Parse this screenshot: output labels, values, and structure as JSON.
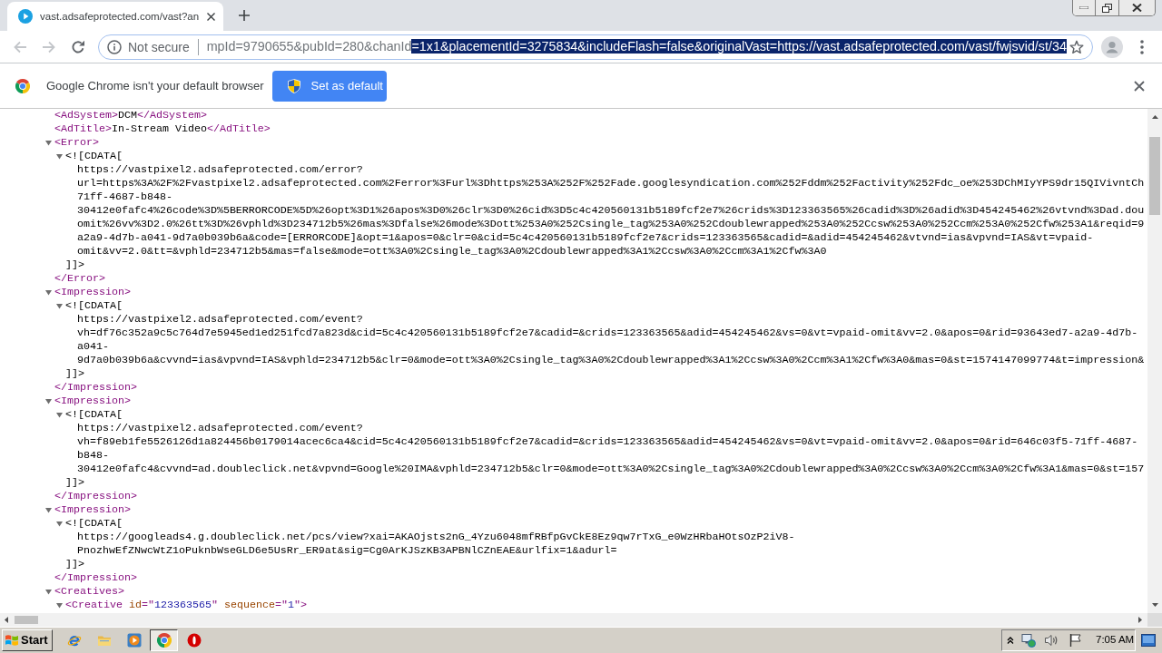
{
  "tabs": [
    {
      "title": "vast.adsafeprotected.com/vast?an",
      "selected": true
    }
  ],
  "toolbar": {
    "back_disabled": true,
    "forward_disabled": true,
    "security_label": "Not secure",
    "url": "mpId=9790655&pubId=280&chanId",
    "url_selection": "=1x1&placementId=3275834&includeFlash=false&originalVast=https://vast.adsafeprotected.com/vast/fwjsvid/st/34"
  },
  "infobar": {
    "message": "Google Chrome isn't your default browser",
    "button": "Set as default"
  },
  "document": [
    {
      "kind": "leaf",
      "open": "<AdSystem>",
      "text": "DCM",
      "close": "</AdSystem>"
    },
    {
      "kind": "leaf",
      "open": "<AdTitle>",
      "text": "In-Stream Video",
      "close": "</AdTitle>"
    },
    {
      "kind": "element",
      "expanded": true,
      "open": "<Error>",
      "children": [
        {
          "kind": "cdata",
          "expanded": true,
          "open": "<![CDATA[",
          "lines": [
            "https://vastpixel2.adsafeprotected.com/error?",
            "url=https%3A%2F%2Fvastpixel2.adsafeprotected.com%2Ferror%3Furl%3Dhttps%253A%252F%252Fade.googlesyndication.com%252Fddm%252Factivity%252Fdc_oe%253DChMIyYPS9dr15QIVivntCh",
            "71ff-4687-b848-",
            "30412e0fafc4%26code%3D%5BERRORCODE%5D%26opt%3D1%26apos%3D0%26clr%3D0%26cid%3D5c4c420560131b5189fcf2e7%26crids%3D123363565%26cadid%3D%26adid%3D454245462%26vtvnd%3Dad.dou",
            "omit%26vv%3D2.0%26tt%3D%26vphld%3D234712b5%26mas%3Dfalse%26mode%3Dott%253A0%252Csingle_tag%253A0%252Cdoublewrapped%253A0%252Ccsw%253A0%252Ccm%253A0%252Cfw%253A1&reqid=9",
            "a2a9-4d7b-a041-9d7a0b039b6a&code=[ERRORCODE]&opt=1&apos=0&clr=0&cid=5c4c420560131b5189fcf2e7&crids=123363565&cadid=&adid=454245462&vtvnd=ias&vpvnd=IAS&vt=vpaid-",
            "omit&vv=2.0&tt=&vphld=234712b5&mas=false&mode=ott%3A0%2Csingle_tag%3A0%2Cdoublewrapped%3A1%2Ccsw%3A0%2Ccm%3A1%2Cfw%3A0"
          ],
          "close": "]]>"
        }
      ],
      "close": "</Error>"
    },
    {
      "kind": "element",
      "expanded": true,
      "open": "<Impression>",
      "children": [
        {
          "kind": "cdata",
          "expanded": true,
          "open": "<![CDATA[",
          "lines": [
            "https://vastpixel2.adsafeprotected.com/event?",
            "vh=df76c352a9c5c764d7e5945ed1ed251fcd7a823d&cid=5c4c420560131b5189fcf2e7&cadid=&crids=123363565&adid=454245462&vs=0&vt=vpaid-omit&vv=2.0&apos=0&rid=93643ed7-a2a9-4d7b-",
            "a041-",
            "9d7a0b039b6a&cvvnd=ias&vpvnd=IAS&vphld=234712b5&clr=0&mode=ott%3A0%2Csingle_tag%3A0%2Cdoublewrapped%3A1%2Ccsw%3A0%2Ccm%3A1%2Cfw%3A0&mas=0&st=1574147099774&t=impression&"
          ],
          "close": "]]>"
        }
      ],
      "close": "</Impression>"
    },
    {
      "kind": "element",
      "expanded": true,
      "open": "<Impression>",
      "children": [
        {
          "kind": "cdata",
          "expanded": true,
          "open": "<![CDATA[",
          "lines": [
            "https://vastpixel2.adsafeprotected.com/event?",
            "vh=f89eb1fe5526126d1a824456b0179014acec6ca4&cid=5c4c420560131b5189fcf2e7&cadid=&crids=123363565&adid=454245462&vs=0&vt=vpaid-omit&vv=2.0&apos=0&rid=646c03f5-71ff-4687-",
            "b848-",
            "30412e0fafc4&cvvnd=ad.doubleclick.net&vpvnd=Google%20IMA&vphld=234712b5&clr=0&mode=ott%3A0%2Csingle_tag%3A0%2Cdoublewrapped%3A0%2Ccsw%3A0%2Ccm%3A0%2Cfw%3A1&mas=0&st=157"
          ],
          "close": "]]>"
        }
      ],
      "close": "</Impression>"
    },
    {
      "kind": "element",
      "expanded": true,
      "open": "<Impression>",
      "children": [
        {
          "kind": "cdata",
          "expanded": true,
          "open": "<![CDATA[",
          "lines": [
            "https://googleads4.g.doubleclick.net/pcs/view?xai=AKAOjsts2nG_4Yzu6048mfRBfpGvCkE8Ez9qw7rTxG_e0WzHRbaHOtsOzP2iV8-",
            "PnozhwEfZNwcWtZ1oPuknbWseGLD6e5UsRr_ER9at&sig=Cg0ArKJSzKB3APBNlCZnEAE&urlfix=1&adurl="
          ],
          "close": "]]>"
        }
      ],
      "close": "</Impression>"
    },
    {
      "kind": "element",
      "expanded": true,
      "open": "<Creatives>",
      "children": [
        {
          "kind": "element",
          "expanded": true,
          "open": [
            {
              "kind": "tag",
              "text": "<Creative "
            },
            {
              "kind": "attribute_name",
              "text": "id"
            },
            {
              "kind": "tag",
              "text": "=\""
            },
            {
              "kind": "attribute_value",
              "text": "123363565"
            },
            {
              "kind": "tag",
              "text": "\" "
            },
            {
              "kind": "attribute_name",
              "text": "sequence"
            },
            {
              "kind": "tag",
              "text": "=\""
            },
            {
              "kind": "attribute_value",
              "text": "1"
            },
            {
              "kind": "tag",
              "text": "\">"
            }
          ]
        }
      ]
    }
  ],
  "taskbar": {
    "start": "Start",
    "apps": [
      {
        "kind": "e_logo",
        "selected": false
      },
      {
        "kind": "folder",
        "selected": false
      },
      {
        "kind": "media",
        "selected": false
      },
      {
        "kind": "chrome",
        "selected": true
      },
      {
        "kind": "ring",
        "selected": false
      }
    ],
    "clock": "7:05 AM"
  }
}
